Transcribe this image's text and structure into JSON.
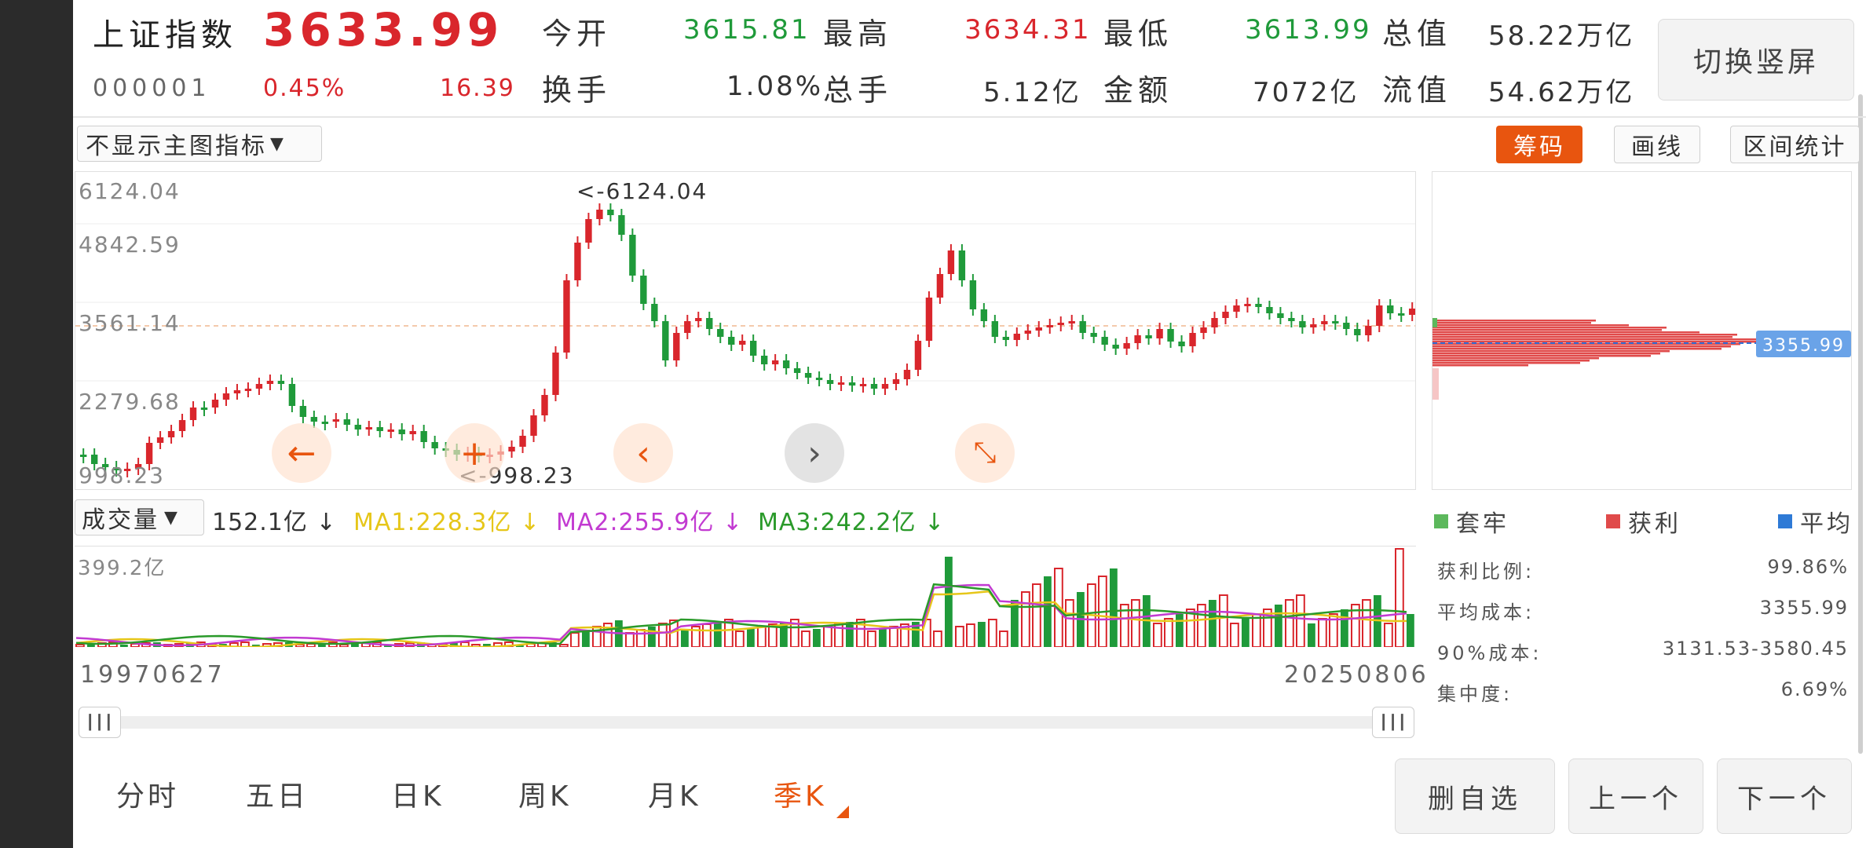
{
  "header": {
    "name": "上证指数",
    "price": "3633.99",
    "code": "000001",
    "change_pct": "0.45%",
    "change": "16.39",
    "stats": [
      {
        "label": "今开",
        "value": "3615.81",
        "color": "green"
      },
      {
        "label": "最高",
        "value": "3634.31",
        "color": "red"
      },
      {
        "label": "最低",
        "value": "3613.99",
        "color": "green"
      },
      {
        "label": "总值",
        "value": "58.22万亿",
        "color": "black"
      },
      {
        "label": "换手",
        "value": "1.08%",
        "color": "black"
      },
      {
        "label": "总手",
        "value": "5.12亿",
        "color": "black"
      },
      {
        "label": "金额",
        "value": "7072亿",
        "color": "black"
      },
      {
        "label": "流值",
        "value": "54.62万亿",
        "color": "black"
      }
    ],
    "switch_label": "切换竖屏"
  },
  "toolbar": {
    "indicator_label": "不显示主图指标",
    "chip_label": "筹码",
    "draw_label": "画线",
    "range_label": "区间统计"
  },
  "kline": {
    "y_labels": [
      "6124.04",
      "4842.59",
      "3561.14",
      "2279.68",
      "998.23"
    ],
    "max_marker": "<-6124.04",
    "min_marker": "<-998.23",
    "ref_price": 3561.14,
    "y_max": 6124.04,
    "y_min": 998.23
  },
  "volume": {
    "indicator_label": "成交量",
    "current": "152.1亿",
    "ma1": "MA1:228.3亿",
    "ma2": "MA2:255.9亿",
    "ma3": "MA3:242.2亿",
    "arrow": "↓",
    "y_max_label": "399.2亿"
  },
  "dates": {
    "start": "19970627",
    "end": "20250806"
  },
  "chips": {
    "price_tag": "3355.99",
    "legend": [
      "套牢",
      "获利",
      "平均"
    ],
    "stats": [
      {
        "label": "获利比例:",
        "value": "99.86%"
      },
      {
        "label": "平均成本:",
        "value": "3355.99"
      },
      {
        "label": "90%成本:",
        "value": "3131.53-3580.45"
      },
      {
        "label": "集中度:",
        "value": "6.69%"
      }
    ]
  },
  "bottom": {
    "tabs": [
      "分时",
      "五日",
      "日K",
      "周K",
      "月K",
      "季K"
    ],
    "active_tab": "季K",
    "buttons": [
      "删自选",
      "上一个",
      "下一个"
    ]
  },
  "colors": {
    "up": "#d9262c",
    "down": "#1f9a3a",
    "accent": "#e8550f",
    "ma1": "#e6c619",
    "ma2": "#c23ad1",
    "ma3": "#2a9a2a"
  }
}
